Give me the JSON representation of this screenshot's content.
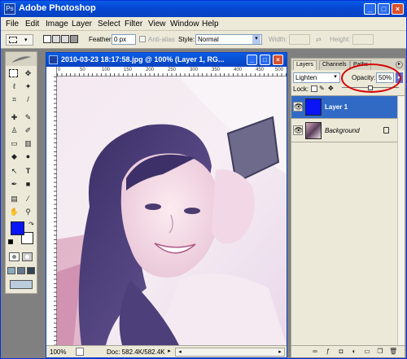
{
  "app": {
    "title": "Adobe Photoshop",
    "ps_icon": "ps-logo-icon"
  },
  "menu": [
    "File",
    "Edit",
    "Image",
    "Layer",
    "Select",
    "Filter",
    "View",
    "Window",
    "Help"
  ],
  "options": {
    "feather_label": "Feather:",
    "feather_value": "0 px",
    "antialias_label": "Anti-alias",
    "style_label": "Style:",
    "style_value": "Normal",
    "width_label": "Width:",
    "height_label": "Height:"
  },
  "document": {
    "title": "2010-03-23 18:17:58.jpg @ 100% (Layer 1, RG...",
    "zoom": "100%",
    "doc_info": "Doc: 582.4K/582.4K",
    "ruler_labels": [
      "0",
      "50",
      "100",
      "150",
      "200",
      "250",
      "300",
      "350",
      "400",
      "450",
      "500"
    ]
  },
  "layers_panel": {
    "tabs": [
      "Layers",
      "Channels",
      "Paths"
    ],
    "blend_mode": "Lighten",
    "opacity_label": "Opacity:",
    "opacity_value": "50%",
    "opacity_fraction": 0.5,
    "lock_label": "Lock:",
    "layers": [
      {
        "name": "Layer 1",
        "selected": true,
        "thumb_color": "#0a14f5"
      },
      {
        "name": "Background",
        "selected": false,
        "locked": true
      }
    ]
  },
  "colors": {
    "foreground": "#0a14f5",
    "background": "#ffffff",
    "accent": "#316ac5",
    "highlight_ring": "#d40000"
  }
}
